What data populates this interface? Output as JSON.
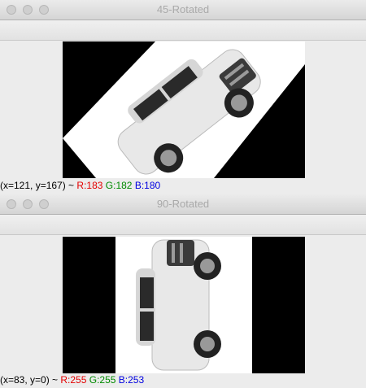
{
  "windows": [
    {
      "title": "45-Rotated",
      "status": {
        "coords": "(x=121, y=167) ~ ",
        "r": "R:183",
        "g": "G:182",
        "b": "B:180"
      }
    },
    {
      "title": "90-Rotated",
      "status": {
        "coords": "(x=83, y=0) ~ ",
        "r": "R:255",
        "g": "G:255",
        "b": "B:253"
      }
    }
  ],
  "colors": {
    "red": "#e30000",
    "green": "#008a00",
    "blue": "#0000e0"
  }
}
